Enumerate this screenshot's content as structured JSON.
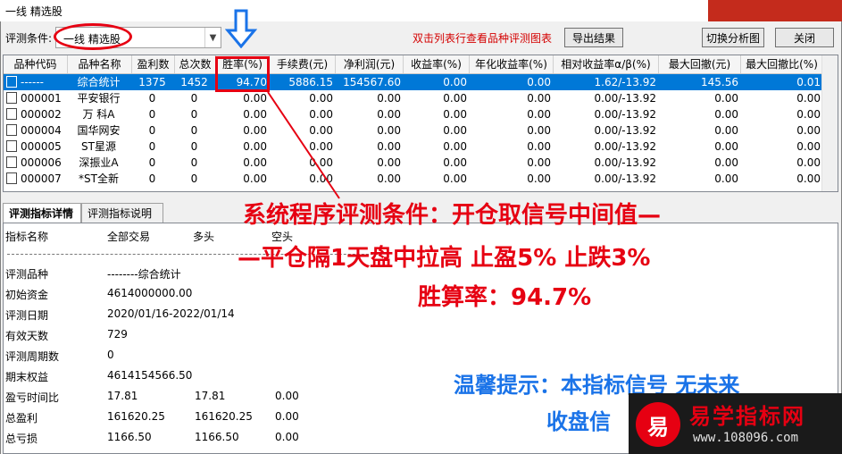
{
  "window": {
    "title": "一线 精选股"
  },
  "toolbar": {
    "condition_label": "评测条件:",
    "condition_value": "一线 精选股",
    "hint": "双击列表行查看品种评测图表",
    "export_label": "导出结果",
    "switch_label": "切换分析图",
    "close_label": "关闭"
  },
  "table": {
    "columns": [
      "品种代码",
      "品种名称",
      "盈利数",
      "总次数",
      "胜率(%)",
      "手续费(元)",
      "净利润(元)",
      "收益率(%)",
      "年化收益率(%)",
      "相对收益率α/β(%)",
      "最大回撤(元)",
      "最大回撤比(%)"
    ],
    "rows": [
      [
        "------",
        "综合统计",
        "1375",
        "1452",
        "94.70",
        "5886.15",
        "154567.60",
        "0.00",
        "0.00",
        "1.62/-13.92",
        "145.56",
        "0.01"
      ],
      [
        "000001",
        "平安银行",
        "0",
        "0",
        "0.00",
        "0.00",
        "0.00",
        "0.00",
        "0.00",
        "0.00/-13.92",
        "0.00",
        "0.00"
      ],
      [
        "000002",
        "万 科A",
        "0",
        "0",
        "0.00",
        "0.00",
        "0.00",
        "0.00",
        "0.00",
        "0.00/-13.92",
        "0.00",
        "0.00"
      ],
      [
        "000004",
        "国华网安",
        "0",
        "0",
        "0.00",
        "0.00",
        "0.00",
        "0.00",
        "0.00",
        "0.00/-13.92",
        "0.00",
        "0.00"
      ],
      [
        "000005",
        "ST星源",
        "0",
        "0",
        "0.00",
        "0.00",
        "0.00",
        "0.00",
        "0.00",
        "0.00/-13.92",
        "0.00",
        "0.00"
      ],
      [
        "000006",
        "深振业A",
        "0",
        "0",
        "0.00",
        "0.00",
        "0.00",
        "0.00",
        "0.00",
        "0.00/-13.92",
        "0.00",
        "0.00"
      ],
      [
        "000007",
        "*ST全新",
        "0",
        "0",
        "0.00",
        "0.00",
        "0.00",
        "0.00",
        "0.00",
        "0.00/-13.92",
        "0.00",
        "0.00"
      ]
    ]
  },
  "tabs": [
    "评测指标详情",
    "评测指标说明"
  ],
  "detail": {
    "header": [
      "指标名称",
      "全部交易",
      "多头",
      "空头"
    ],
    "rows": [
      [
        "评测品种",
        "--------综合统计",
        "",
        ""
      ],
      [
        "初始资金",
        "4614000000.00",
        "",
        ""
      ],
      [
        "评测日期",
        "2020/01/16-2022/01/14",
        "",
        ""
      ],
      [
        "有效天数",
        "729",
        "",
        ""
      ],
      [
        "评测周期数",
        "0",
        "",
        ""
      ],
      [
        "期末权益",
        "4614154566.50",
        "",
        ""
      ],
      [
        "盈亏时间比",
        "17.81",
        "17.81",
        "0.00"
      ],
      [
        "总盈利",
        "161620.25",
        "161620.25",
        "0.00"
      ],
      [
        "总亏损",
        "1166.50",
        "1166.50",
        "0.00"
      ]
    ]
  },
  "overlay": {
    "line1": "系统程序评测条件：开仓取信号中间值—",
    "line2": "—平仓隔1天盘中拉高  止盈5%  止跌3%",
    "line3": "胜算率：94.7%",
    "tip1": "温馨提示：本指标信号 无未来",
    "tip2": "收盘信"
  },
  "watermark": {
    "logo": "易",
    "title": "易学指标网",
    "url": "www.108096.com"
  },
  "colors": {
    "accent_red": "#e60012",
    "selection_blue": "#0078d7",
    "tip_blue": "#1a73e8"
  }
}
